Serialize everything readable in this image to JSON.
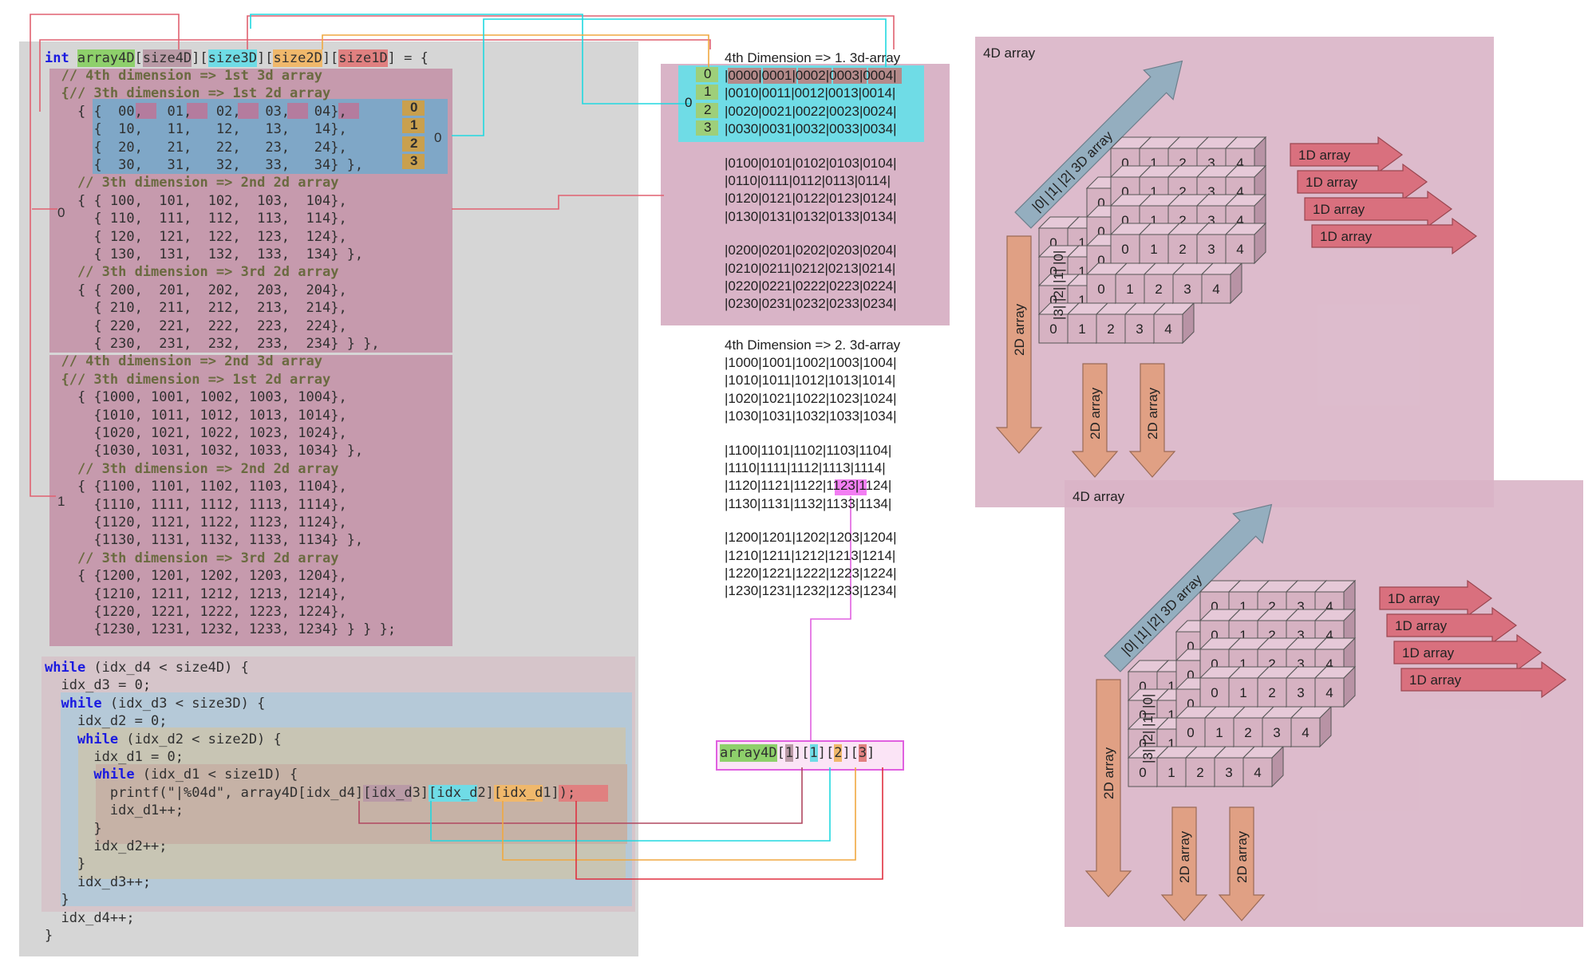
{
  "colors": {
    "d4": "#8ed06b",
    "size4D": "#b99aa6",
    "size3D": "#6fdce6",
    "size2D": "#f0b86b",
    "size1D": "#e08080",
    "panel_pink": "#d9b4c7",
    "panel_gray": "#d6d6d6"
  },
  "decl": {
    "type": "int",
    "name": "array4D",
    "s4": "size4D",
    "s3": "size3D",
    "s2": "size2D",
    "s1": "size1D",
    "tail": " = {"
  },
  "code_init": [
    "  // 4th dimension => 1st 3d array",
    "  {// 3th dimension => 1st 2d array",
    "    { {  00,   01,   02,   03,   04},",
    "      {  10,   11,   12,   13,   14},",
    "      {  20,   21,   22,   23,   24},",
    "      {  30,   31,   32,   33,   34} },",
    "    // 3th dimension => 2nd 2d array",
    "    { { 100,  101,  102,  103,  104},",
    "      { 110,  111,  112,  113,  114},",
    "      { 120,  121,  122,  123,  124},",
    "      { 130,  131,  132,  133,  134} },",
    "    // 3th dimension => 3rd 2d array",
    "    { { 200,  201,  202,  203,  204},",
    "      { 210,  211,  212,  213,  214},",
    "      { 220,  221,  222,  223,  224},",
    "      { 230,  231,  232,  233,  234} } },",
    "  // 4th dimension => 2nd 3d array",
    "  {// 3th dimension => 1st 2d array",
    "    { {1000, 1001, 1002, 1003, 1004},",
    "      {1010, 1011, 1012, 1013, 1014},",
    "      {1020, 1021, 1022, 1023, 1024},",
    "      {1030, 1031, 1032, 1033, 1034} },",
    "    // 3th dimension => 2nd 2d array",
    "    { {1100, 1101, 1102, 1103, 1104},",
    "      {1110, 1111, 1112, 1113, 1114},",
    "      {1120, 1121, 1122, 1123, 1124},",
    "      {1130, 1131, 1132, 1133, 1134} },",
    "    // 3th dimension => 3rd 2d array",
    "    { {1200, 1201, 1202, 1203, 1204},",
    "      {1210, 1211, 1212, 1213, 1214},",
    "      {1220, 1221, 1222, 1223, 1224},",
    "      {1230, 1231, 1232, 1233, 1234} } } };"
  ],
  "code_loop": [
    "while (idx_d4 < size4D) {",
    "  idx_d3 = 0;",
    "  while (idx_d3 < size3D) {",
    "    idx_d2 = 0;",
    "    while (idx_d2 < size2D) {",
    "      idx_d1 = 0;",
    "      while (idx_d1 < size1D) {",
    "        printf(\"|%04d\", array4D[idx_d4][idx_d3][idx_d2][idx_d1]);",
    "        idx_d1++;",
    "      }",
    "      idx_d2++;",
    "    }",
    "    idx_d3++;",
    "  }",
    "  idx_d4++;",
    "}"
  ],
  "row_labels": [
    "0",
    "1",
    "2",
    "3"
  ],
  "block_labels": {
    "d3_zero": "0",
    "d4_zero": "0",
    "d4_one": "1",
    "right_zero": "0"
  },
  "output": {
    "header1": "4th Dimension => 1. 3d-array",
    "block1": [
      [
        "|0000|0001|0002|0003|0004|",
        "|0010|0011|0012|0013|0014|",
        "|0020|0021|0022|0023|0024|",
        "|0030|0031|0032|0033|0034|"
      ],
      [
        "|0100|0101|0102|0103|0104|",
        "|0110|0111|0112|0113|0114|",
        "|0120|0121|0122|0123|0124|",
        "|0130|0131|0132|0133|0134|"
      ],
      [
        "|0200|0201|0202|0203|0204|",
        "|0210|0211|0212|0213|0214|",
        "|0220|0221|0222|0223|0224|",
        "|0230|0231|0232|0233|0234|"
      ]
    ],
    "header2": "4th Dimension => 2. 3d-array",
    "block2": [
      [
        "|1000|1001|1002|1003|1004|",
        "|1010|1011|1012|1013|1014|",
        "|1020|1021|1022|1023|1024|",
        "|1030|1031|1032|1033|1034|"
      ],
      [
        "|1100|1101|1102|1103|1104|",
        "|1110|1111|1112|1113|1114|",
        "|1120|1121|1122|1123|1124|",
        "|1130|1131|1132|1133|1134|"
      ],
      [
        "|1200|1201|1202|1203|1204|",
        "|1210|1211|1212|1213|1214|",
        "|1220|1221|1222|1223|1224|",
        "|1230|1231|1232|1233|1234|"
      ]
    ],
    "highlight": "1123"
  },
  "access": {
    "name": "array4D",
    "i4": "1",
    "i3": "1",
    "i2": "2",
    "i1": "3"
  },
  "cube_diagram": {
    "title": "4D array",
    "diag_label": "|0|   |1|    |2|  3D array",
    "vert_label": "|3| |2| |1| |0|",
    "row_label": "1D array",
    "col_label": "2D array",
    "cell_values": [
      "0",
      "1",
      "2",
      "3",
      "4"
    ]
  }
}
